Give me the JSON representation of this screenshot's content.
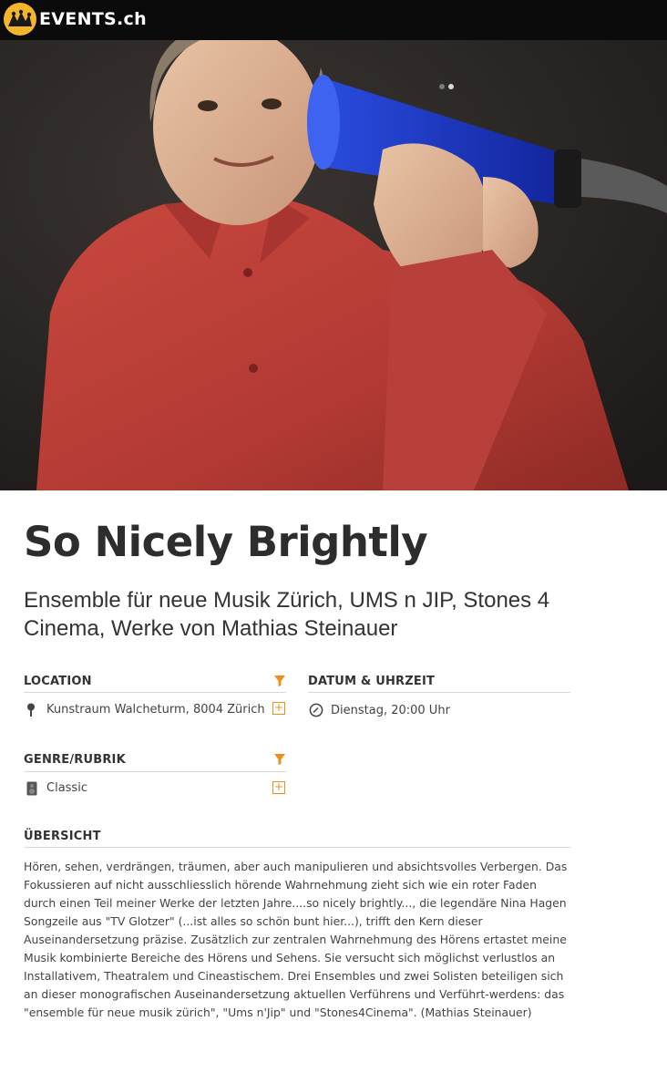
{
  "header": {
    "logo_text": "EVENTS.ch",
    "brand_color": "#f3b52c"
  },
  "hero": {
    "slides_total": 2,
    "active_slide": 2
  },
  "event": {
    "title": "So Nicely Brightly",
    "subtitle": "Ensemble für neue Musik Zürich, UMS n JIP, Stones 4 Cinema, Werke von Mathias Steinauer"
  },
  "location": {
    "heading": "LOCATION",
    "value": "Kunstraum Walcheturm, 8004 Zürich",
    "icon": "map-pin-icon"
  },
  "datetime": {
    "heading": "DATUM & UHRZEIT",
    "value": "Dienstag, 20:00 Uhr",
    "icon": "clock-icon"
  },
  "genre": {
    "heading": "GENRE/RUBRIK",
    "value": "Classic",
    "icon": "speaker-icon"
  },
  "overview": {
    "heading": "ÜBERSICHT",
    "text": "Hören, sehen, verdrängen, träumen, aber auch manipulieren und absichtsvolles Verbergen. Das Fokussieren auf nicht ausschliesslich hörende Wahrnehmung zieht sich wie ein roter Faden durch einen Teil meiner Werke der letzten Jahre....so nicely brightly..., die legendäre Nina Hagen Songzeile aus \"TV Glotzer\" (...ist alles so schön bunt hier...), trifft den Kern dieser Auseinandersetzung präzise. Zusätzlich zur zentralen Wahrnehmung des Hörens ertastet meine Musik kombinierte Bereiche des Hörens und Sehens. Sie versucht sich möglichst verlustlos an Installativem, Theatralem und Cineastischem. Drei Ensembles und zwei Solisten beteiligen sich an dieser monografischen Auseinandersetzung aktuellen Verführens und Verführt-werdens: das \"ensemble für neue musik zürich\", \"Ums n'Jip\" und \"Stones4Cinema\". (Mathias Steinauer)"
  },
  "colors": {
    "accent": "#f28c1b",
    "text": "#333333",
    "rule": "#d9d9d9"
  }
}
